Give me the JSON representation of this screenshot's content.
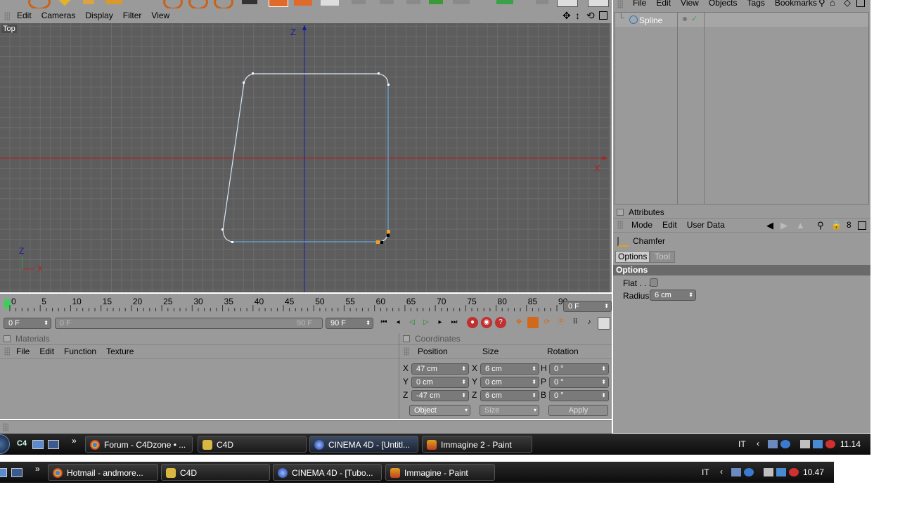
{
  "viewport": {
    "menu": [
      "Edit",
      "Cameras",
      "Display",
      "Filter",
      "View"
    ],
    "label": "Top",
    "axis_z": "Z",
    "axis_x": "X",
    "mini_z": "Z",
    "mini_x": "X"
  },
  "timeline": {
    "ticks": [
      "0",
      "5",
      "10",
      "15",
      "20",
      "25",
      "30",
      "35",
      "40",
      "45",
      "50",
      "55",
      "60",
      "65",
      "70",
      "75",
      "80",
      "85",
      "90"
    ],
    "current_frame": "0 F",
    "start_frame": "0 F",
    "range_start": "0 F",
    "range_end": "90 F",
    "end_frame": "90 F"
  },
  "materials": {
    "title": "Materials",
    "menu": [
      "File",
      "Edit",
      "Function",
      "Texture"
    ]
  },
  "coordinates": {
    "title": "Coordinates",
    "headers": [
      "Position",
      "Size",
      "Rotation"
    ],
    "rows": [
      {
        "axis": "X",
        "pos": "47 cm",
        "size_axis": "X",
        "size": "6 cm",
        "rot_axis": "H",
        "rot": "0 °"
      },
      {
        "axis": "Y",
        "pos": "0 cm",
        "size_axis": "Y",
        "size": "0 cm",
        "rot_axis": "P",
        "rot": "0 °"
      },
      {
        "axis": "Z",
        "pos": "-47 cm",
        "size_axis": "Z",
        "size": "6 cm",
        "rot_axis": "B",
        "rot": "0 °"
      }
    ],
    "mode_select": "Object",
    "size_select": "Size",
    "apply": "Apply"
  },
  "objects": {
    "menu": [
      "File",
      "Edit",
      "View",
      "Objects",
      "Tags",
      "Bookmarks"
    ],
    "items": [
      {
        "name": "Spline"
      }
    ]
  },
  "attributes": {
    "title": "Attributes",
    "menu": [
      "Mode",
      "Edit",
      "User Data"
    ],
    "tool_name": "Chamfer",
    "tabs": [
      "Options",
      "Tool"
    ],
    "section": "Options",
    "flat_label": "Flat . . .",
    "radius_label": "Radius",
    "radius_value": "6 cm"
  },
  "taskbar1": {
    "quick": "C4",
    "buttons": [
      "Forum - C4Dzone • ...",
      "C4D",
      "CINEMA 4D - [Untitl...",
      "Immagine 2 - Paint"
    ],
    "lang": "IT",
    "clock": "11.14"
  },
  "taskbar2": {
    "buttons": [
      "Hotmail - andmore...",
      "C4D",
      "CINEMA 4D - [Tubo...",
      "Immagine - Paint"
    ],
    "lang": "IT",
    "clock": "10.47"
  },
  "colors": {
    "viewport_bg": "#5d5d5d",
    "grid": "#6c6c6c",
    "x_axis": "#b02020",
    "z_axis": "#1a1aa8",
    "spline": "#d8e6f5",
    "spline_selected": "#6aa8e0",
    "point_selected": "#f0a020"
  }
}
